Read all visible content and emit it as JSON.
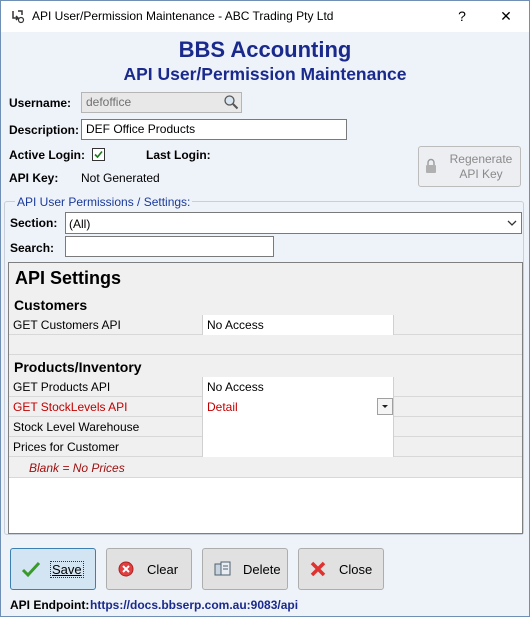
{
  "window": {
    "title": "API User/Permission Maintenance - ABC Trading Pty Ltd",
    "help_label": "?",
    "close_label": "✕"
  },
  "header": {
    "brand": "BBS Accounting",
    "subtitle": "API User/Permission Maintenance"
  },
  "form": {
    "username_label": "Username:",
    "username_value": "defoffice",
    "description_label": "Description:",
    "description_value": "DEF Office Products",
    "active_login_label": "Active Login:",
    "active_login_checked": true,
    "last_login_label": "Last Login:",
    "last_login_value": "",
    "api_key_label": "API Key:",
    "api_key_value": "Not Generated",
    "regenerate_label_line1": "Regenerate",
    "regenerate_label_line2": "API Key"
  },
  "permissions": {
    "group_label": "API User Permissions / Settings:",
    "section_label": "Section:",
    "section_value": "(All)",
    "search_label": "Search:",
    "search_value": ""
  },
  "grid": {
    "title": "API Settings",
    "sections": [
      {
        "name": "Customers",
        "rows": [
          {
            "name": "GET Customers API",
            "value": "No Access",
            "highlight": false
          }
        ]
      },
      {
        "name": "Products/Inventory",
        "rows": [
          {
            "name": "GET Products API",
            "value": "No Access",
            "highlight": false
          },
          {
            "name": "GET StockLevels API",
            "value": "Detail",
            "highlight": true
          },
          {
            "name": "Stock Level Warehouse",
            "value": "",
            "highlight": false
          },
          {
            "name": "Prices for Customer",
            "value": "",
            "highlight": false
          }
        ]
      }
    ],
    "note": "Blank = No Prices",
    "highlight_color": "#c00000"
  },
  "buttons": {
    "save": "Save",
    "clear": "Clear",
    "delete": "Delete",
    "close": "Close"
  },
  "footer": {
    "endpoint_label": "API Endpoint:",
    "endpoint_value": "https://docs.bbserp.com.au:9083/api"
  },
  "colors": {
    "brand": "#1a2a8c",
    "group_label": "#1a3a9c",
    "background": "#eef2f9"
  }
}
